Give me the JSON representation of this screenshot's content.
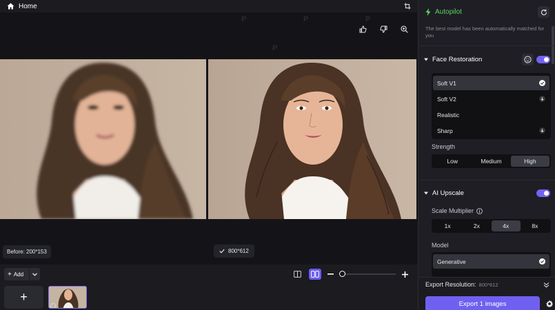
{
  "topbar": {
    "home_label": "Home"
  },
  "compare": {
    "before_label": "Before: 200*153",
    "after_label": "800*612"
  },
  "bottombar": {
    "add_label": "Add",
    "add_tile": "+"
  },
  "panel": {
    "autopilot_title": "Autopilot",
    "autopilot_desc": "The best model has been automatically matched for you",
    "face_restoration": {
      "title": "Face Restoration",
      "options": [
        {
          "label": "Soft V1",
          "state": "selected"
        },
        {
          "label": "Soft V2",
          "state": "download"
        },
        {
          "label": "Realistic",
          "state": "none"
        },
        {
          "label": "Sharp",
          "state": "download"
        }
      ],
      "strength_label": "Strength",
      "strength_options": [
        "Low",
        "Medium",
        "High"
      ],
      "strength_selected": "High"
    },
    "ai_upscale": {
      "title": "AI Upscale",
      "scale_label": "Scale Multiplier",
      "scale_options": [
        "1x",
        "2x",
        "4x",
        "8x"
      ],
      "scale_selected": "4x",
      "model_label": "Model",
      "model_options": [
        {
          "label": "Generative",
          "state": "selected"
        }
      ]
    },
    "export": {
      "resolution_label": "Export Resolution:",
      "resolution_value": "800*612",
      "button_label": "Export 1 images"
    }
  },
  "colors": {
    "accent": "#7060f0",
    "autopilot_green": "#5cd65c",
    "panel_bg": "#1e1e24"
  }
}
